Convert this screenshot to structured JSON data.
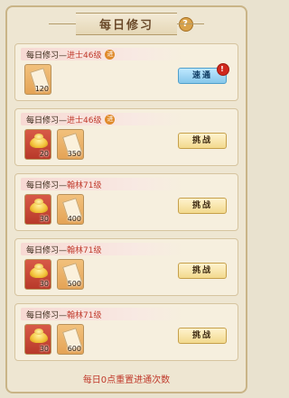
{
  "title": "每日修习",
  "help_icon": "?",
  "footer_text": "每日0点重置进通次数",
  "cards": [
    {
      "title": "每日修习—",
      "level": "进士46级",
      "items": [
        {
          "type": "paper",
          "count": "120"
        }
      ],
      "button": {
        "label": "速通",
        "style": "sweep",
        "badge": "!"
      }
    },
    {
      "title": "每日修习—",
      "level": "进士46级",
      "items": [
        {
          "type": "gold",
          "count": "20"
        },
        {
          "type": "paper",
          "count": "350"
        }
      ],
      "button": {
        "label": "挑战",
        "style": "challenge"
      }
    },
    {
      "title": "每日修习—",
      "level": "翰林71级",
      "items": [
        {
          "type": "gold",
          "count": "30"
        },
        {
          "type": "paper",
          "count": "400"
        }
      ],
      "button": {
        "label": "挑战",
        "style": "challenge"
      }
    },
    {
      "title": "每日修习—",
      "level": "翰林71级",
      "items": [
        {
          "type": "gold",
          "count": "30"
        },
        {
          "type": "paper",
          "count": "500"
        }
      ],
      "button": {
        "label": "挑战",
        "style": "challenge"
      }
    },
    {
      "title": "每日修习—",
      "level": "翰林71级",
      "items": [
        {
          "type": "gold",
          "count": "30"
        },
        {
          "type": "paper",
          "count": "600"
        }
      ],
      "button": {
        "label": "挑战",
        "style": "challenge"
      }
    }
  ]
}
